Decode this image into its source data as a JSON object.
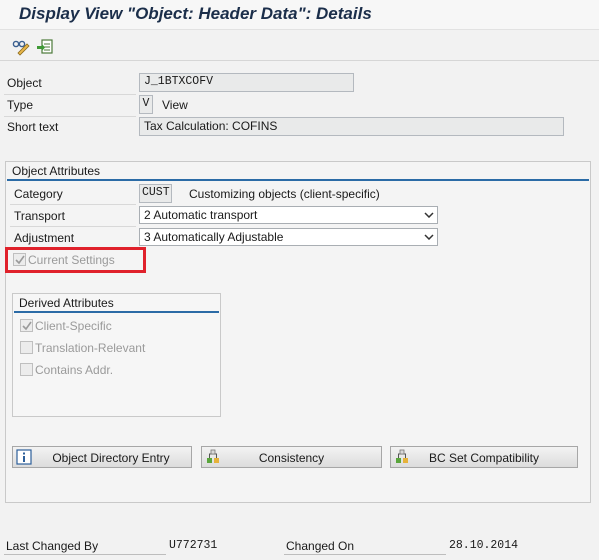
{
  "window": {
    "title": "Display View \"Object: Header Data\": Details"
  },
  "toolbar": {
    "icons": [
      "glasses-pencil-icon",
      "other-object-icon"
    ]
  },
  "header": {
    "object_label": "Object",
    "object_value": "J_1BTXCOFV",
    "type_label": "Type",
    "type_code": "V",
    "type_text": "View",
    "short_text_label": "Short text",
    "short_text_value": "Tax Calculation: COFINS"
  },
  "object_attributes": {
    "title": "Object Attributes",
    "category_label": "Category",
    "category_code": "CUST",
    "category_text": "Customizing objects (client-specific)",
    "transport_label": "Transport",
    "transport_value": "2 Automatic transport",
    "adjustment_label": "Adjustment",
    "adjustment_value": "3 Automatically Adjustable",
    "current_settings_label": "Current Settings",
    "current_settings_checked": true
  },
  "derived_attributes": {
    "title": "Derived Attributes",
    "items": [
      {
        "label": "Client-Specific",
        "checked": true
      },
      {
        "label": "Translation-Relevant",
        "checked": false
      },
      {
        "label": "Contains Addr.",
        "checked": false
      }
    ]
  },
  "buttons": {
    "object_directory_entry": "Object Directory Entry",
    "consistency": "Consistency",
    "bc_set_compatibility": "BC Set Compatibility"
  },
  "footer": {
    "last_changed_by_label": "Last Changed By",
    "last_changed_by_value": "U772731",
    "changed_on_label": "Changed On",
    "changed_on_value": "28.10.2014"
  },
  "colors": {
    "highlight": "#e0212b",
    "group_rule": "#2b6ba6",
    "title_text": "#1b2e4a"
  }
}
